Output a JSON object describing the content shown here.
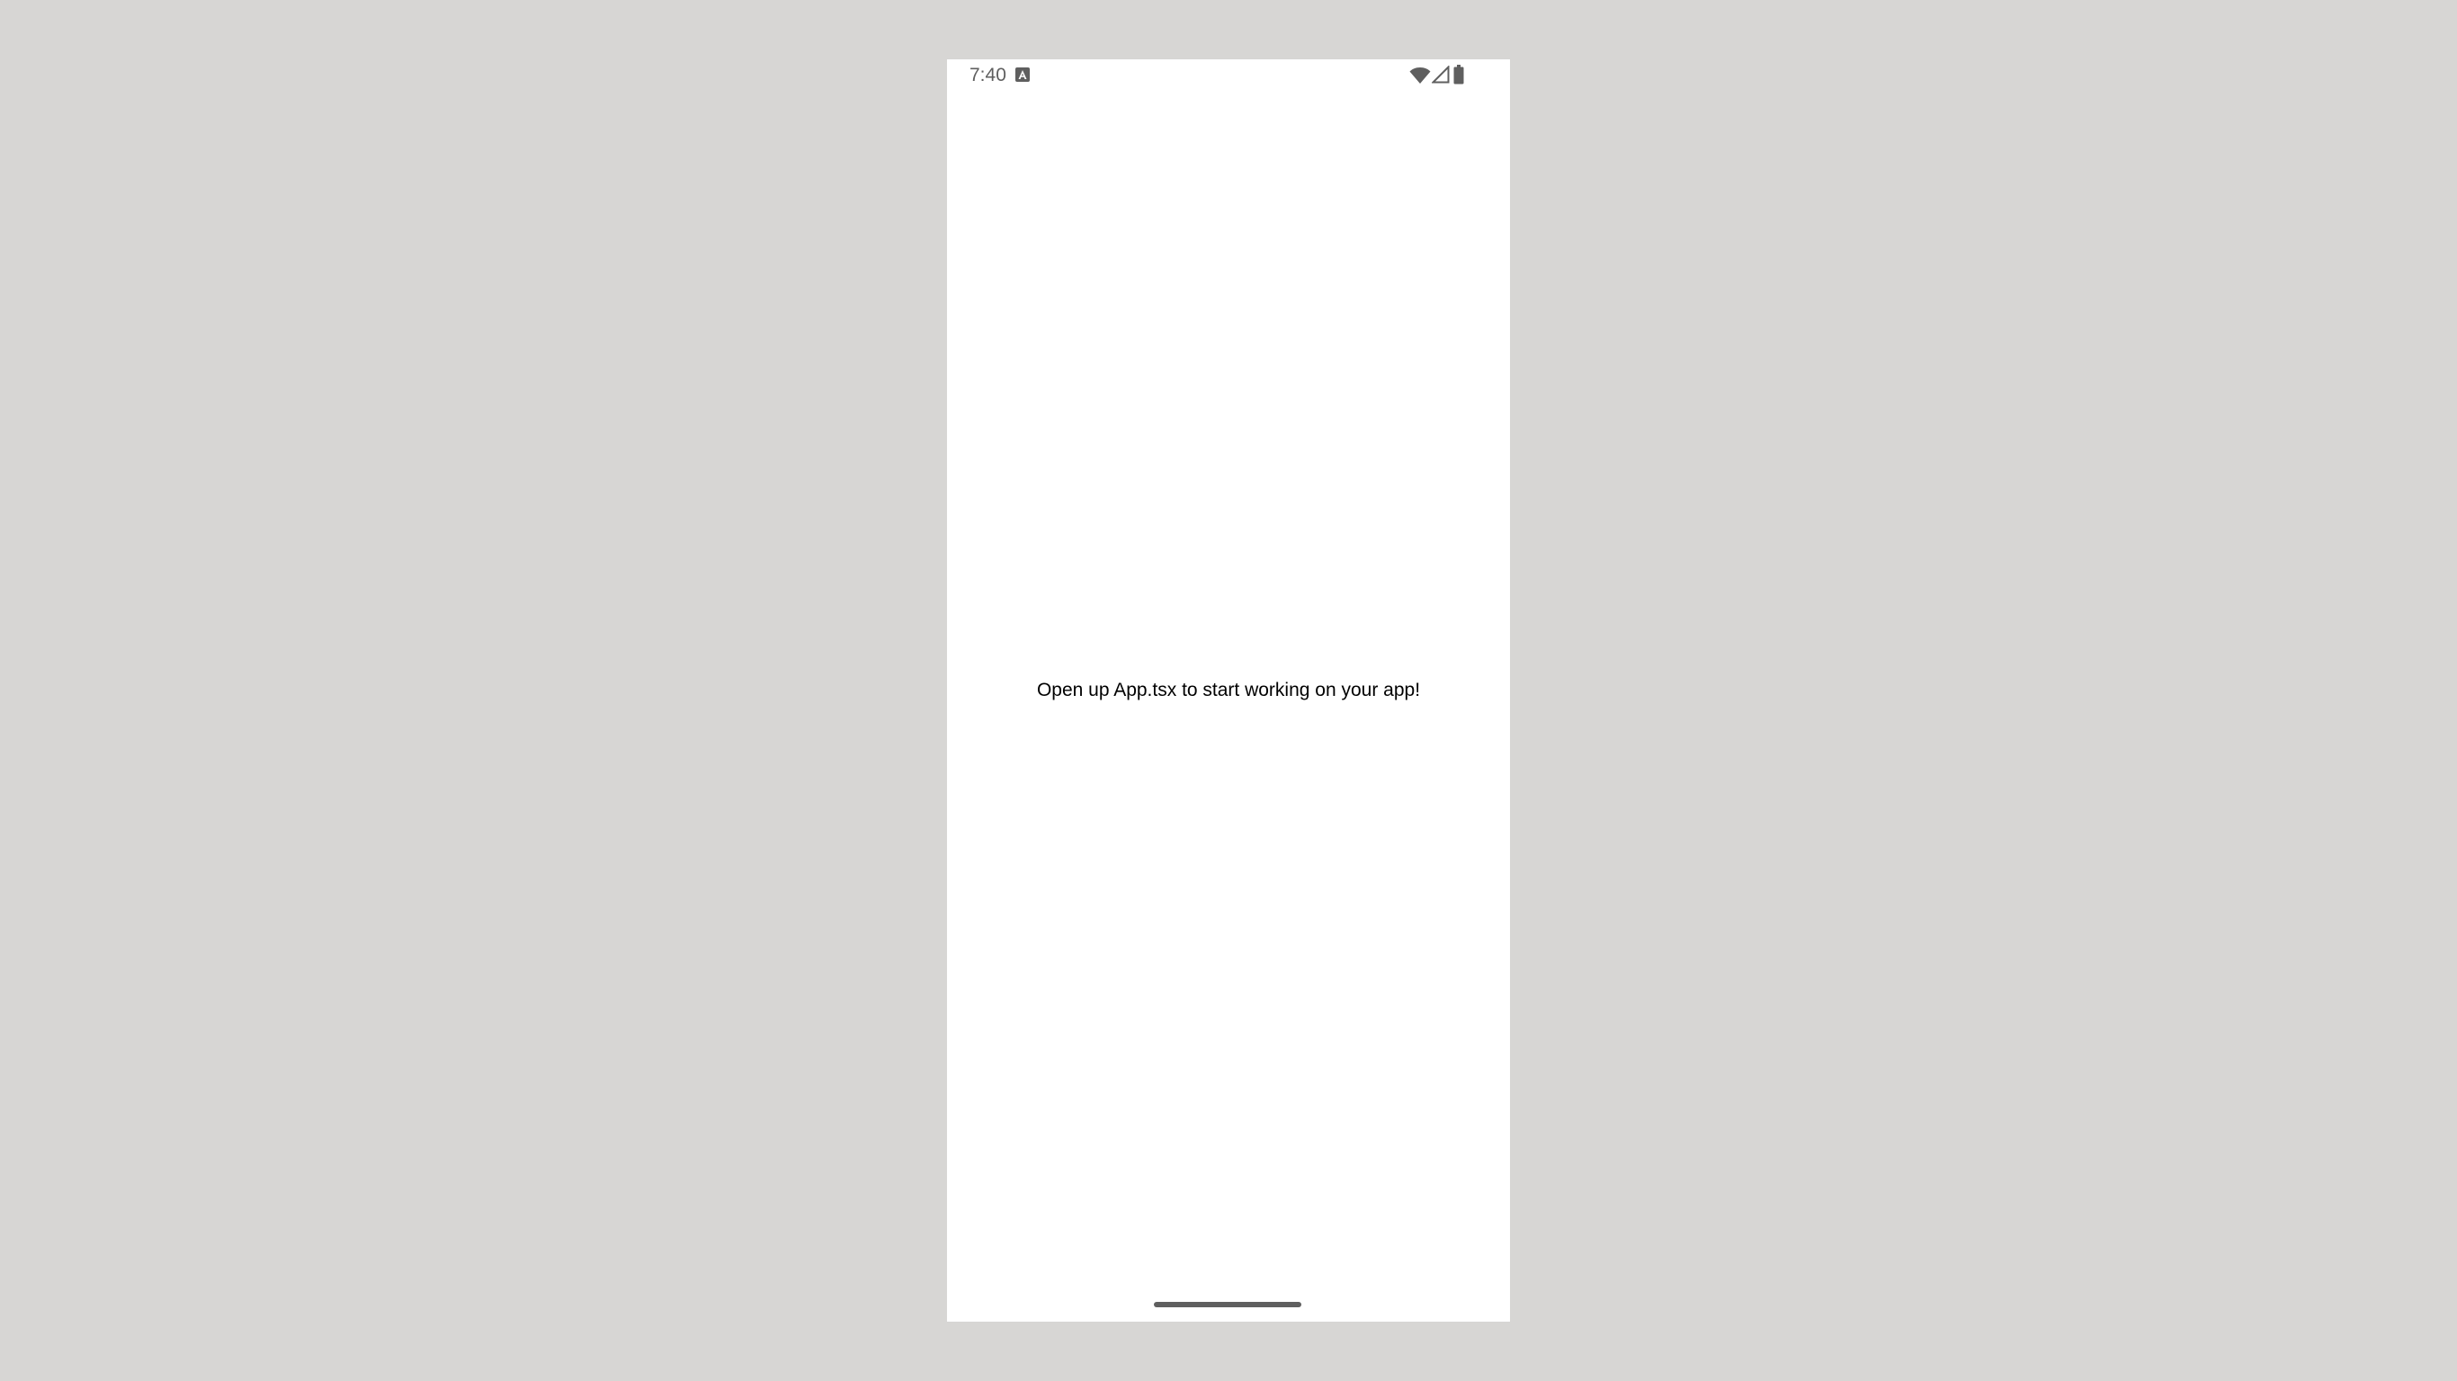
{
  "status_bar": {
    "time": "7:40",
    "icon_color": "#5f5f5f",
    "icons": [
      "notification-a-icon",
      "wifi-icon",
      "cell-signal-icon",
      "battery-icon"
    ]
  },
  "app": {
    "message": "Open up App.tsx to start working on your app!"
  },
  "colors": {
    "background": "#d7d6d4",
    "screen": "#ffffff",
    "text": "#000000"
  }
}
